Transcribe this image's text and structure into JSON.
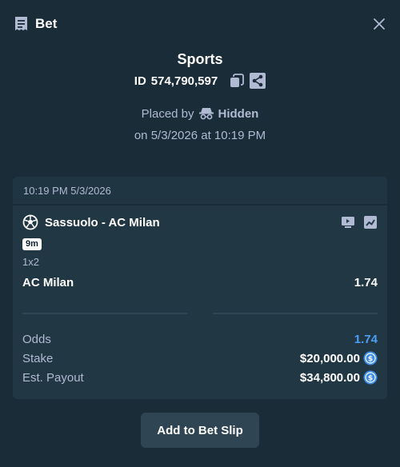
{
  "header": {
    "title": "Bet"
  },
  "bet": {
    "game": "Sports",
    "id_label": "ID",
    "id_value": "574,790,597",
    "placed_by_label": "Placed by",
    "user": "Hidden",
    "date_line": "on 5/3/2026 at 10:19 PM"
  },
  "card": {
    "timestamp": "10:19 PM 5/3/2026",
    "match": "Sassuolo - AC Milan",
    "live_badge": "9m",
    "market": "1x2",
    "selection": "AC Milan",
    "selection_odds": "1.74",
    "stats": [
      {
        "label": "Odds",
        "value": "1.74"
      },
      {
        "label": "Stake",
        "value": "$20,000.00"
      },
      {
        "label": "Est. Payout",
        "value": "$34,800.00"
      }
    ]
  },
  "actions": {
    "add_to_slip": "Add to Bet Slip"
  },
  "colors": {
    "background": "#1a2c38",
    "card": "#213743",
    "odds_accent": "#4d9ef6",
    "coin": "#3b8ef0",
    "button": "#2f4553"
  },
  "icons": {
    "title": "receipt-icon",
    "close": "close-icon",
    "copy": "copy-icon",
    "share": "share-icon",
    "hidden_user": "incognito-icon",
    "sport": "soccer-ball-icon",
    "live_stream": "live-stream-icon",
    "stats": "stats-chart-icon",
    "currency": "usd-coin-icon"
  }
}
